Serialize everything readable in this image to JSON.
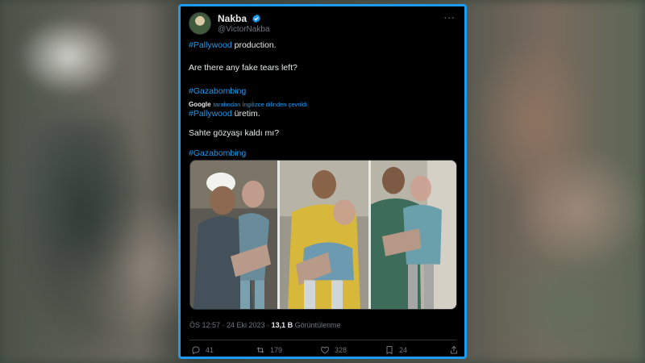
{
  "tweet": {
    "display_name": "Nakba",
    "handle": "@VictorNakba",
    "text": {
      "hashtag_pallywood_1": "#Pallywood",
      "line1_rest": " production.",
      "line2": "Are there any fake tears left?",
      "hashtag_gazabombing_1": "#Gazabombing",
      "translated_by": "Google",
      "translated_note": "tarafından İngilizce dilinden çevrildi",
      "hashtag_pallywood_2": "#Pallywood",
      "line4_rest": " üretim.",
      "line5": "Sahte gözyaşı kaldı mı?",
      "hashtag_gazabombing_2": "#Gazabombing"
    },
    "timestamp": "ÖS 12:57 · 24 Eki 2023 · ",
    "views_count": "13,1 B",
    "views_label": " Görüntülenme",
    "actions": {
      "replies": "41",
      "reposts": "179",
      "likes": "328",
      "bookmarks": "24"
    }
  },
  "colors": {
    "accent": "#1d9bf0",
    "background": "#000000",
    "text": "#e7e9ea",
    "muted": "#71767b"
  },
  "icons": [
    "verified-badge-icon",
    "more-options-icon",
    "reply-icon",
    "repost-icon",
    "like-icon",
    "bookmark-icon",
    "share-icon"
  ]
}
